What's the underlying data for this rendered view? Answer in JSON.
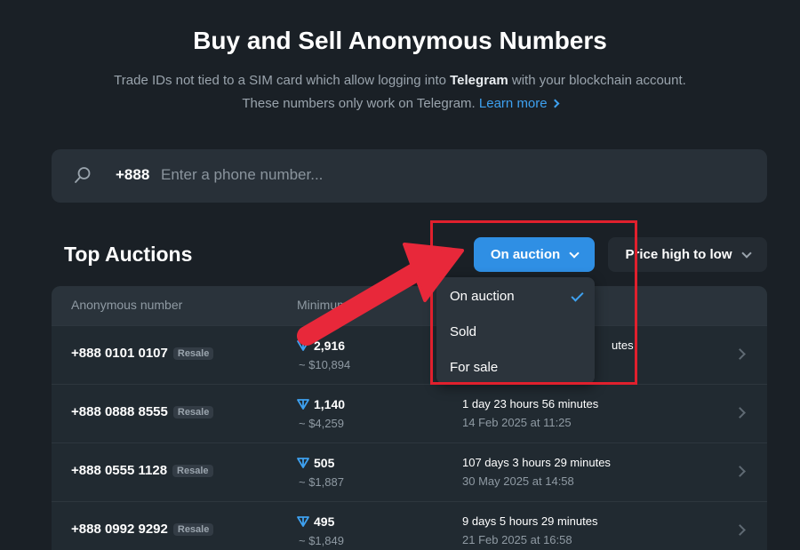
{
  "header": {
    "title": "Buy and Sell Anonymous Numbers",
    "subtitle_line1_pre": "Trade IDs not tied to a SIM card which allow logging into ",
    "subtitle_line1_bold": "Telegram",
    "subtitle_line1_post": " with your blockchain account.",
    "subtitle_line2": "These numbers only work on Telegram.",
    "learn_more": "Learn more"
  },
  "search": {
    "prefix": "+888",
    "placeholder": "Enter a phone number...",
    "value": ""
  },
  "section": {
    "title": "Top Auctions"
  },
  "filters": {
    "status_selected": "On auction",
    "sort_selected": "Price high to low"
  },
  "status_menu": {
    "items": [
      "On auction",
      "Sold",
      "For sale"
    ],
    "checked": "On auction"
  },
  "table": {
    "columns": [
      "Anonymous number",
      "Minimum"
    ],
    "rows": [
      {
        "number": "+888 0101 0107",
        "badge": "Resale",
        "price": "2,916",
        "usd": "~ $10,894",
        "time": "utes",
        "date": ""
      },
      {
        "number": "+888 0888 8555",
        "badge": "Resale",
        "price": "1,140",
        "usd": "~ $4,259",
        "time": "1 day 23 hours 56 minutes",
        "date": "14 Feb 2025 at 11:25"
      },
      {
        "number": "+888 0555 1128",
        "badge": "Resale",
        "price": "505",
        "usd": "~ $1,887",
        "time": "107 days 3 hours 29 minutes",
        "date": "30 May 2025 at 14:58"
      },
      {
        "number": "+888 0992 9292",
        "badge": "Resale",
        "price": "495",
        "usd": "~ $1,849",
        "time": "9 days 5 hours 29 minutes",
        "date": "21 Feb 2025 at 16:58"
      }
    ]
  },
  "colors": {
    "background": "#1a2026",
    "accent": "#2f8fe4",
    "link": "#3ea1f0",
    "annotation": "#e0202d"
  },
  "icons": {
    "search": "search-icon",
    "currency": "ton-icon",
    "check": "check-icon"
  }
}
